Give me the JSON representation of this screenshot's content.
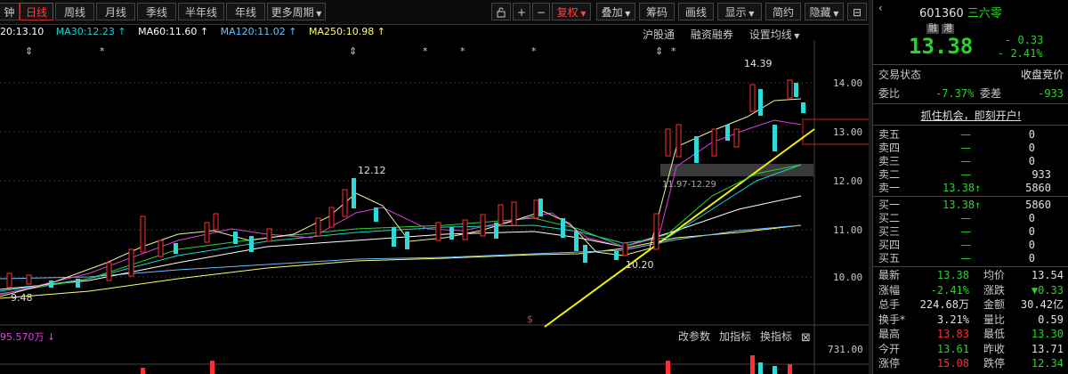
{
  "toolbar": {
    "partial_tab": "钟",
    "tabs": [
      "日线",
      "周线",
      "月线",
      "季线",
      "半年线",
      "年线"
    ],
    "more_period": "更多周期",
    "restore": "复权",
    "overlay": "叠加",
    "chips": "筹码",
    "draw": "画线",
    "display": "显示",
    "simple": "简约",
    "hide": "隐藏"
  },
  "ma_line": [
    {
      "text": "20:13.10",
      "color": "#ffffff"
    },
    {
      "text": "MA30:12.23 ↑",
      "color": "#19d4d4"
    },
    {
      "text": "MA60:11.60 ↑",
      "color": "#ffffff"
    },
    {
      "text": "MA120:11.02 ↑",
      "color": "#66c2ff"
    },
    {
      "text": "MA250:10.98 ↑",
      "color": "#ffff66"
    }
  ],
  "chart_links": [
    "沪股通",
    "融资融券",
    "设置均线"
  ],
  "price_axis": [
    "14.00",
    "13.00",
    "12.00",
    "11.00",
    "10.00"
  ],
  "annotations": {
    "high": "14.39",
    "peak_left": "12.12",
    "low_left": "9.48",
    "low_mid": "10.20",
    "range": "11.97-12.29"
  },
  "volume_panel": {
    "label": "95.570万 ↓",
    "buttons": [
      "改参数",
      "加指标",
      "换指标"
    ],
    "close": "⊠",
    "axis": "731.00"
  },
  "stock": {
    "code": "601360",
    "name": "三六零",
    "tag1": "融",
    "tag2": "港",
    "price": "13.38",
    "change": "- 0.33",
    "change_pct": "- 2.41%"
  },
  "trade_status": {
    "label": "交易状态",
    "value": "收盘竞价"
  },
  "weibi": {
    "label1": "委比",
    "value1": "-7.37%",
    "label2": "委差",
    "value2": "-933"
  },
  "open_account": "抓住机会，即刻开户!",
  "sell_rows": [
    {
      "label": "卖五",
      "price": "—",
      "vol": "0"
    },
    {
      "label": "卖四",
      "price": "—",
      "vol": "0"
    },
    {
      "label": "卖三",
      "price": "—",
      "vol": "0"
    },
    {
      "label": "卖二",
      "price": "—",
      "vol": "933"
    },
    {
      "label": "卖一",
      "price": "13.38↑",
      "vol": "5860"
    }
  ],
  "buy_rows": [
    {
      "label": "买一",
      "price": "13.38↑",
      "vol": "5860"
    },
    {
      "label": "买二",
      "price": "—",
      "vol": "0"
    },
    {
      "label": "买三",
      "price": "—",
      "vol": "0"
    },
    {
      "label": "买四",
      "price": "—",
      "vol": "0"
    },
    {
      "label": "买五",
      "price": "—",
      "vol": "0"
    }
  ],
  "stats": [
    {
      "l1": "最新",
      "v1": "13.38",
      "c1": "#22d822",
      "l2": "均价",
      "v2": "13.54",
      "c2": "#e0e0e0"
    },
    {
      "l1": "涨幅",
      "v1": "-2.41%",
      "c1": "#22d822",
      "l2": "涨跌",
      "v2": "▼0.33",
      "c2": "#22d822"
    },
    {
      "l1": "总手",
      "v1": "224.68万",
      "c1": "#e0e0e0",
      "l2": "金额",
      "v2": "30.42亿",
      "c2": "#e0e0e0"
    },
    {
      "l1": "换手*",
      "v1": "3.21%",
      "c1": "#e0e0e0",
      "l2": "量比",
      "v2": "0.59",
      "c2": "#e0e0e0"
    },
    {
      "l1": "最高",
      "v1": "13.83",
      "c1": "#ff3030",
      "l2": "最低",
      "v2": "13.30",
      "c2": "#22d822"
    },
    {
      "l1": "今开",
      "v1": "13.61",
      "c1": "#22d822",
      "l2": "昨收",
      "v2": "13.71",
      "c2": "#e0e0e0"
    },
    {
      "l1": "涨停",
      "v1": "15.08",
      "c1": "#ff3030",
      "l2": "跌停",
      "v2": "12.34",
      "c2": "#22d822"
    }
  ]
}
